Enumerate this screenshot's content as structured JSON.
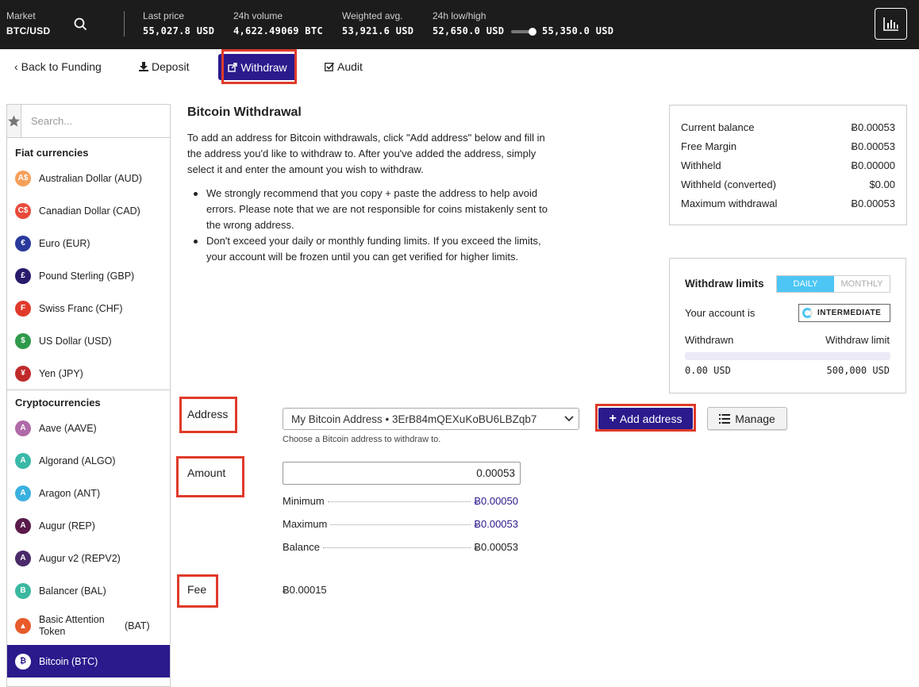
{
  "topbar": {
    "market_label": "Market",
    "market_value": "BTC/USD",
    "last_price_label": "Last price",
    "last_price_value": "55,027.8 USD",
    "volume_label": "24h volume",
    "volume_value": "4,622.49069 BTC",
    "wavg_label": "Weighted avg.",
    "wavg_value": "53,921.6 USD",
    "lowhigh_label": "24h low/high",
    "low_value": "52,650.0 USD",
    "high_value": "55,350.0 USD"
  },
  "nav": {
    "back": "Back to Funding",
    "deposit": "Deposit",
    "withdraw": "Withdraw",
    "audit": "Audit"
  },
  "sidebar": {
    "search_placeholder": "Search...",
    "fiat_heading": "Fiat currencies",
    "fiat": [
      {
        "label": "Australian Dollar (AUD)",
        "symbol": "A$",
        "color": "#f5a05a"
      },
      {
        "label": "Canadian Dollar (CAD)",
        "symbol": "C$",
        "color": "#e84a3a"
      },
      {
        "label": "Euro (EUR)",
        "symbol": "€",
        "color": "#2a3a9c"
      },
      {
        "label": "Pound Sterling (GBP)",
        "symbol": "£",
        "color": "#2a1a6c"
      },
      {
        "label": "Swiss Franc (CHF)",
        "symbol": "F",
        "color": "#e03a2a"
      },
      {
        "label": "US Dollar (USD)",
        "symbol": "$",
        "color": "#2e9a4a"
      },
      {
        "label": "Yen (JPY)",
        "symbol": "¥",
        "color": "#c02a2a"
      }
    ],
    "crypto_heading": "Cryptocurrencies",
    "crypto": [
      {
        "label": "Aave (AAVE)",
        "symbol": "A",
        "color": "#b06aa8"
      },
      {
        "label": "Algorand (ALGO)",
        "symbol": "A",
        "color": "#3ab8a8"
      },
      {
        "label": "Aragon (ANT)",
        "symbol": "A",
        "color": "#3ab0e0"
      },
      {
        "label": "Augur (REP)",
        "symbol": "A",
        "color": "#5a1a4a"
      },
      {
        "label": "Augur v2 (REPV2)",
        "symbol": "A",
        "color": "#4a2a6a"
      },
      {
        "label": "Balancer (BAL)",
        "symbol": "B",
        "color": "#3ab8a0"
      }
    ],
    "bat_name": "Basic Attention Token",
    "bat_code": "(BAT)",
    "bat_color": "#e85a2a",
    "btc_label": "Bitcoin (BTC)"
  },
  "main": {
    "title": "Bitcoin Withdrawal",
    "intro": "To add an address for Bitcoin withdrawals, click \"Add address\" below and fill in the address you'd like to withdraw to. After you've added the address, simply select it and enter the amount you wish to withdraw.",
    "bullet1": "We strongly recommend that you copy + paste the address to help avoid errors. Please note that we are not responsible for coins mistakenly sent to the wrong address.",
    "bullet2": "Don't exceed your daily or monthly funding limits. If you exceed the limits, your account will be frozen until you can get verified for higher limits."
  },
  "balances": [
    {
      "label": "Current balance",
      "value": "Ƀ0.00053"
    },
    {
      "label": "Free Margin",
      "value": "Ƀ0.00053"
    },
    {
      "label": "Withheld",
      "value": "Ƀ0.00000"
    },
    {
      "label": "Withheld (converted)",
      "value": "$0.00"
    },
    {
      "label": "Maximum withdrawal",
      "value": "Ƀ0.00053"
    }
  ],
  "limits": {
    "title": "Withdraw limits",
    "daily": "DAILY",
    "monthly": "MONTHLY",
    "account_label": "Your account is",
    "tier": "INTERMEDIATE",
    "withdrawn_label": "Withdrawn",
    "limit_label": "Withdraw limit",
    "withdrawn_value": "0.00 USD",
    "limit_value": "500,000 USD",
    "progress_fraction": 0
  },
  "form": {
    "address_label": "Address",
    "address_selected": "My Bitcoin Address • 3ErB84mQEXuKoBU6LBZqb7",
    "address_help": "Choose a Bitcoin address to withdraw to.",
    "add_address": "Add address",
    "manage": "Manage",
    "amount_label": "Amount",
    "amount_value": "0.00053",
    "minimum_label": "Minimum",
    "minimum_value": "Ƀ0.00050",
    "maximum_label": "Maximum",
    "maximum_value": "Ƀ0.00053",
    "balance_label": "Balance",
    "balance_value": "Ƀ0.00053",
    "fee_label": "Fee",
    "fee_value": "Ƀ0.00015"
  }
}
